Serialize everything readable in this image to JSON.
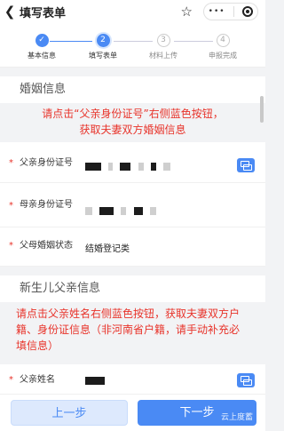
{
  "topbar": {
    "back_icon": "chevron-left-icon",
    "title": "填写表单",
    "star_icon": "star-outline-icon",
    "more_label": "•••",
    "target_icon": "target-icon"
  },
  "steps": [
    {
      "number": "✓",
      "label": "基本信息",
      "state": "done"
    },
    {
      "number": "2",
      "label": "填写表单",
      "state": "active"
    },
    {
      "number": "3",
      "label": "材料上传",
      "state": "pending"
    },
    {
      "number": "4",
      "label": "申报完成",
      "state": "pending"
    }
  ],
  "marriage": {
    "heading": "婚姻信息",
    "notice_line1": "请点击“父亲身份证号”右侧蓝色按钮，",
    "notice_line2": "获取夫妻双方婚姻信息",
    "father_id_label": "父亲身份证号",
    "mother_id_label": "母亲身份证号",
    "status_label": "父母婚姻状态",
    "status_value": "结婚登记类"
  },
  "newborn_father": {
    "heading": "新生儿父亲信息",
    "notice": "请点击父亲姓名右侧蓝色按钮，获取夫妻双方户籍、身份证信息（非河南省户籍，请手动补充必填信息）",
    "name_label": "父亲姓名"
  },
  "footer": {
    "prev_label": "上一步",
    "next_label": "下一步",
    "watermark": "云上度蓄"
  },
  "colors": {
    "accent": "#4a8af4",
    "notice": "#e8332a"
  }
}
